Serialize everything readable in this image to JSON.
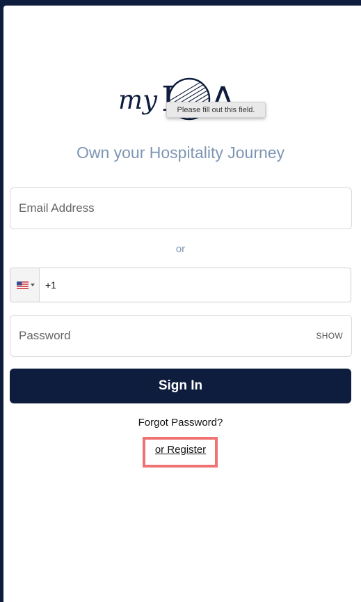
{
  "logo": {
    "text_my": "my",
    "text_l": "L",
    "text_a": "A",
    "brand_color": "#0e1d3d"
  },
  "tooltip": {
    "text": "Please fill out this field."
  },
  "tagline": "Own your Hospitality Journey",
  "email": {
    "placeholder": "Email Address",
    "value": ""
  },
  "separator": "or",
  "phone": {
    "country_icon": "us-flag-icon",
    "value": "+1"
  },
  "password": {
    "placeholder": "Password",
    "value": "",
    "show_label": "SHOW"
  },
  "signin_label": "Sign In",
  "forgot_label": "Forgot Password?",
  "register_label": "or Register",
  "colors": {
    "background": "#0e1d3d",
    "accent": "#7d96b4",
    "button": "#0e1d3d",
    "highlight": "#f07373"
  }
}
